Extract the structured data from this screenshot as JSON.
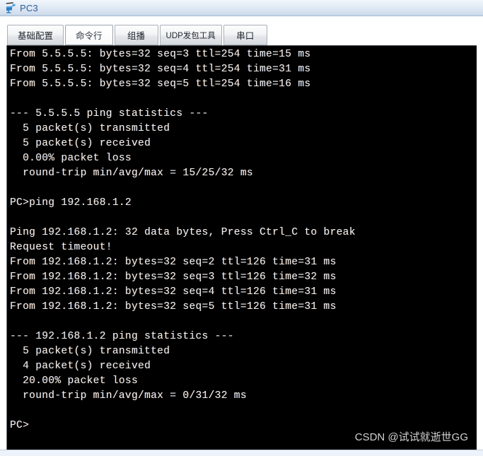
{
  "window": {
    "title": "PC3",
    "icon": "pc-device-icon"
  },
  "tabs": [
    {
      "label": "基础配置",
      "name": "tab-basic-config",
      "active": false
    },
    {
      "label": "命令行",
      "name": "tab-command-line",
      "active": true
    },
    {
      "label": "组播",
      "name": "tab-multicast",
      "active": false
    },
    {
      "label": "UDP发包工具",
      "name": "tab-udp-tool",
      "active": false
    },
    {
      "label": "串口",
      "name": "tab-serial-port",
      "active": false
    }
  ],
  "terminal": {
    "background_color": "#000000",
    "text_color": "#f0f0f0",
    "lines": [
      "From 5.5.5.5: bytes=32 seq=3 ttl=254 time=15 ms",
      "From 5.5.5.5: bytes=32 seq=4 ttl=254 time=31 ms",
      "From 5.5.5.5: bytes=32 seq=5 ttl=254 time=16 ms",
      "",
      "--- 5.5.5.5 ping statistics ---",
      "  5 packet(s) transmitted",
      "  5 packet(s) received",
      "  0.00% packet loss",
      "  round-trip min/avg/max = 15/25/32 ms",
      "",
      "PC>ping 192.168.1.2",
      "",
      "Ping 192.168.1.2: 32 data bytes, Press Ctrl_C to break",
      "Request timeout!",
      "From 192.168.1.2: bytes=32 seq=2 ttl=126 time=31 ms",
      "From 192.168.1.2: bytes=32 seq=3 ttl=126 time=32 ms",
      "From 192.168.1.2: bytes=32 seq=4 ttl=126 time=31 ms",
      "From 192.168.1.2: bytes=32 seq=5 ttl=126 time=31 ms",
      "",
      "--- 192.168.1.2 ping statistics ---",
      "  5 packet(s) transmitted",
      "  4 packet(s) received",
      "  20.00% packet loss",
      "  round-trip min/avg/max = 0/31/32 ms",
      "",
      "PC>"
    ]
  },
  "watermark": {
    "text": "CSDN @试试就逝世GG"
  }
}
